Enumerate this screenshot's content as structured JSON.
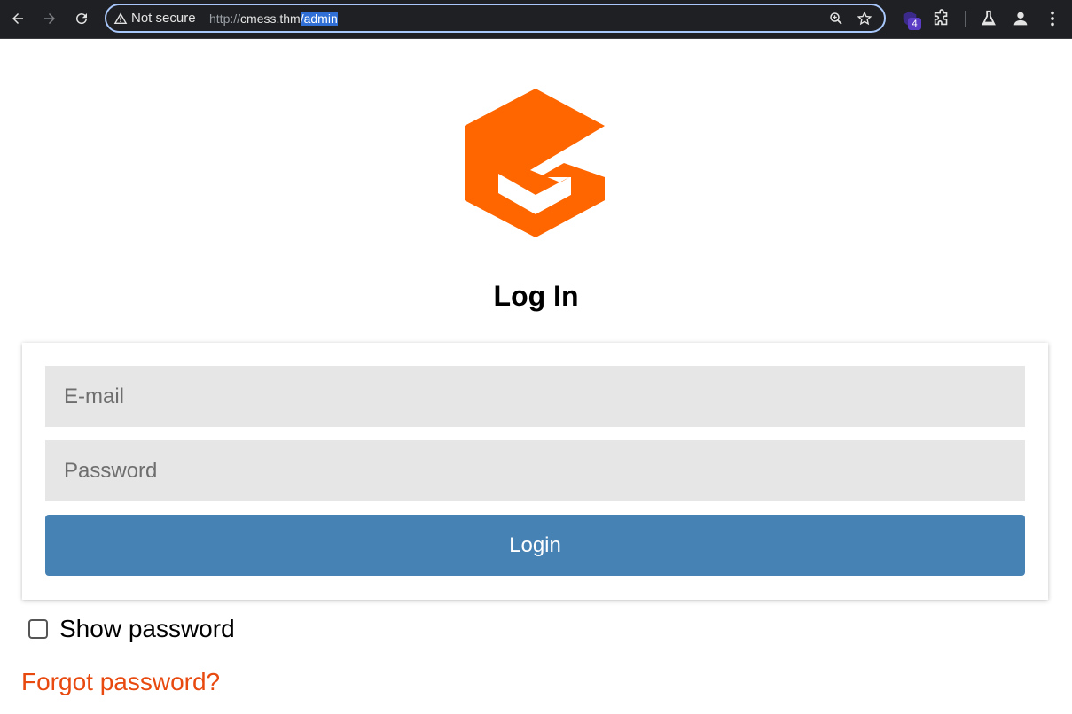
{
  "browser": {
    "security_label": "Not secure",
    "url_scheme": "http://",
    "url_host": "cmess.thm",
    "url_path": "/admin",
    "extension_badge": "4"
  },
  "colors": {
    "logo": "#ff6600",
    "login_button": "#4682b4",
    "forgot_link": "#e8490f",
    "field_background": "#e6e6e6"
  },
  "page": {
    "heading": "Log In",
    "email_placeholder": "E-mail",
    "password_placeholder": "Password",
    "login_label": "Login",
    "show_password_label": "Show password",
    "forgot_password_label": "Forgot password?"
  }
}
